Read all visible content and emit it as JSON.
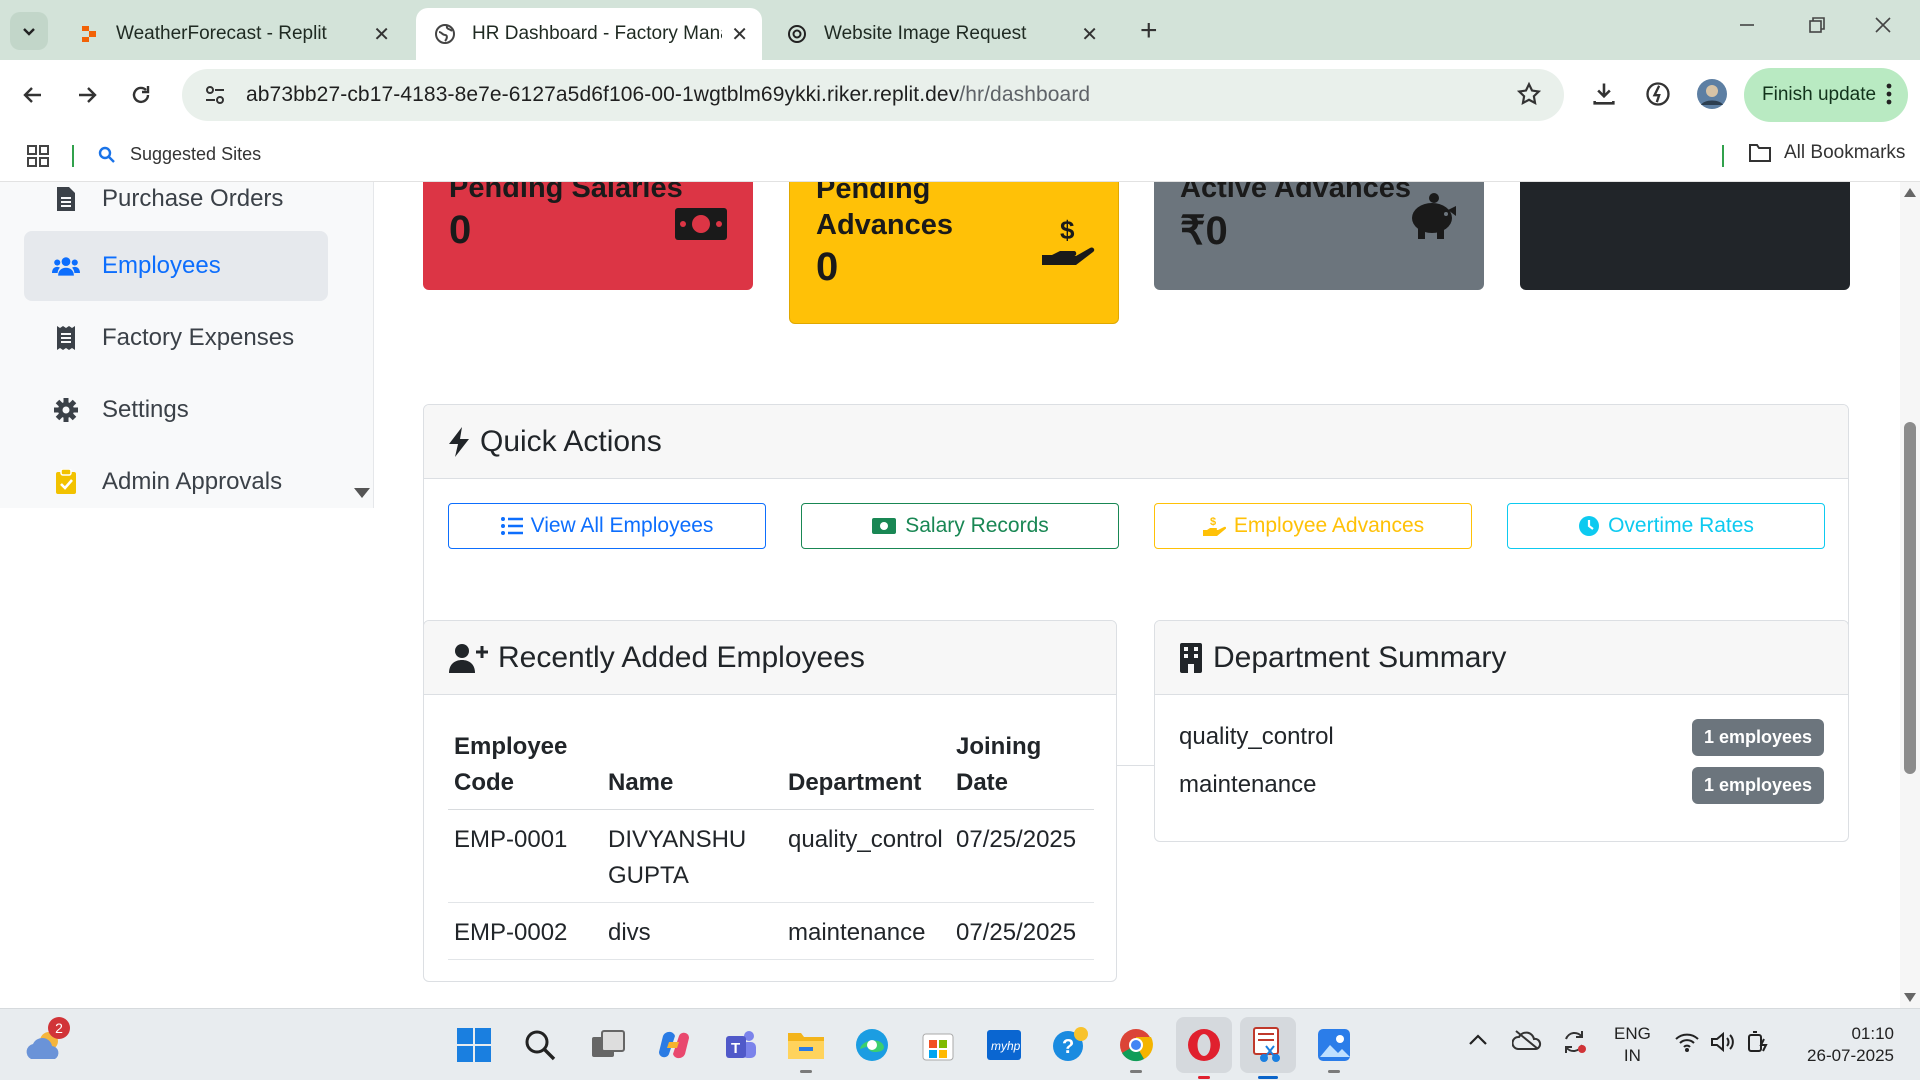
{
  "browser": {
    "tabs": [
      {
        "title": "WeatherForecast - Replit",
        "active": false
      },
      {
        "title": "HR Dashboard - Factory Manag",
        "active": true
      },
      {
        "title": "Website Image Request",
        "active": false
      }
    ],
    "url_host": "ab73bb27-cb17-4183-8e7e-6127a5d6f106-00-1wgtblm69ykki.riker.replit.dev",
    "url_path": "/hr/dashboard",
    "finish_update_label": "Finish update",
    "bookmarks": {
      "suggested": "Suggested Sites",
      "all": "All Bookmarks"
    }
  },
  "sidebar": {
    "items": [
      {
        "label": "Purchase Orders",
        "icon": "file-invoice-icon",
        "active": false
      },
      {
        "label": "Employees",
        "icon": "users-icon",
        "active": true
      },
      {
        "label": "Factory Expenses",
        "icon": "receipt-icon",
        "active": false
      },
      {
        "label": "Settings",
        "icon": "gear-icon",
        "active": false
      },
      {
        "label": "Admin Approvals",
        "icon": "clipboard-check-icon",
        "active": false
      }
    ]
  },
  "stats": [
    {
      "label": "Pending Salaries",
      "value": "0",
      "color": "#dc3545",
      "icon": "money-bill-icon"
    },
    {
      "label": "Pending Advances",
      "value": "0",
      "color": "#ffc107",
      "icon": "hand-holding-dollar-icon"
    },
    {
      "label": "Active Advances",
      "value": "₹0",
      "color": "#6c757d",
      "icon": "piggy-bank-icon"
    },
    {
      "label": "",
      "value": "",
      "color": "#212529",
      "icon": ""
    }
  ],
  "quick_actions": {
    "title": "Quick Actions",
    "buttons": [
      {
        "label": "View All Employees",
        "color": "#0d6efd",
        "icon": "list-icon"
      },
      {
        "label": "Salary Records",
        "color": "#198754",
        "icon": "money-bill-icon"
      },
      {
        "label": "Employee Advances",
        "color": "#ffc107",
        "icon": "hand-holding-dollar-icon"
      },
      {
        "label": "Overtime Rates",
        "color": "#0dcaf0",
        "icon": "clock-icon"
      }
    ]
  },
  "recent_employees": {
    "title": "Recently Added Employees",
    "columns": [
      "Employee Code",
      "Name",
      "Department",
      "Joining Date"
    ],
    "rows": [
      {
        "code": "EMP-0001",
        "name": "DIVYANSHU GUPTA",
        "department": "quality_control",
        "joining_date": "07/25/2025"
      },
      {
        "code": "EMP-0002",
        "name": "divs",
        "department": "maintenance",
        "joining_date": "07/25/2025"
      }
    ]
  },
  "department_summary": {
    "title": "Department Summary",
    "rows": [
      {
        "department": "quality_control",
        "count": "1 employees"
      },
      {
        "department": "maintenance",
        "count": "1 employees"
      }
    ]
  },
  "taskbar": {
    "notification_count": "2",
    "lang_line1": "ENG",
    "lang_line2": "IN",
    "time": "01:10",
    "date": "26-07-2025"
  }
}
